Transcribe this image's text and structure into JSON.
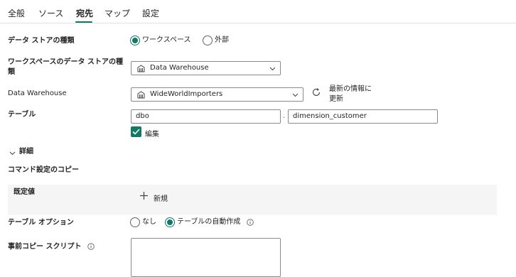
{
  "tabs": [
    {
      "label": "全般"
    },
    {
      "label": "ソース"
    },
    {
      "label": "宛先"
    },
    {
      "label": "マップ"
    },
    {
      "label": "設定"
    }
  ],
  "active_tab": "宛先",
  "accent_color": "#117865",
  "form": {
    "store_type": {
      "label": "データ ストアの種類",
      "options": [
        "ワークスペース",
        "外部"
      ],
      "selected": "ワークスペース"
    },
    "workspace_store_type": {
      "label": "ワークスペースのデータ ストアの種類",
      "value": "Data Warehouse"
    },
    "data_warehouse": {
      "label": "Data Warehouse",
      "value": "WideWorldImporters",
      "refresh_label": "最新の情報に更新"
    },
    "table": {
      "label": "テーブル",
      "schema": "dbo",
      "separator": ".",
      "name": "dimension_customer",
      "edit_label": "編集",
      "edit_checked": true
    },
    "details_label": "詳細",
    "copy_command_label": "コマンド設定のコピー",
    "default_values": {
      "label": "既定値",
      "new_label": "新規"
    },
    "table_option": {
      "label": "テーブル オプション",
      "options": [
        "なし",
        "テーブルの自動作成"
      ],
      "selected": "テーブルの自動作成"
    },
    "pre_copy_script": {
      "label": "事前コピー スクリプト",
      "value": ""
    }
  }
}
